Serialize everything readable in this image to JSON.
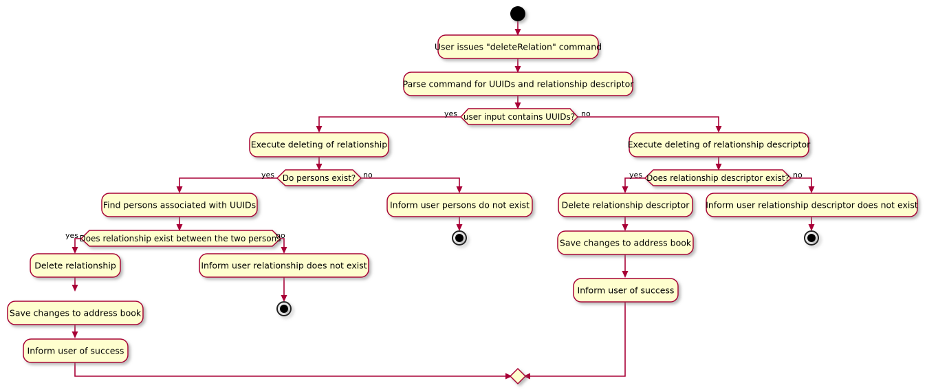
{
  "diagram": {
    "type": "uml-activity-diagram",
    "title": "deleteRelation command activity diagram",
    "background_color": "#FFFFFF",
    "node_fill_color": "#FEFECE",
    "node_border_color": "#A80036",
    "edge_color": "#A80036",
    "text_color": "#000000"
  },
  "start_node": {
    "label": "start"
  },
  "activities": [
    {
      "id": "a1",
      "label": "User issues \"deleteRelation\" command"
    },
    {
      "id": "a2",
      "label": "Parse command for UUIDs and relationship descriptor"
    },
    {
      "id": "a3",
      "label": "Execute deleting of relationship"
    },
    {
      "id": "a4",
      "label": "Execute deleting of relationship descriptor"
    },
    {
      "id": "a5",
      "label": "Find persons associated with UUIDs"
    },
    {
      "id": "a6",
      "label": "Inform user persons do not exist"
    },
    {
      "id": "a7",
      "label": "Delete relationship descriptor"
    },
    {
      "id": "a8",
      "label": "Inform user relationship descriptor does not exist"
    },
    {
      "id": "a9",
      "label": "Delete relationship"
    },
    {
      "id": "a10",
      "label": "Inform user relationship does not exist"
    },
    {
      "id": "a11",
      "label": "Save changes to address book"
    },
    {
      "id": "a12",
      "label": "Inform user of success"
    },
    {
      "id": "a13",
      "label": "Save changes to address book"
    },
    {
      "id": "a14",
      "label": "Inform user of success"
    }
  ],
  "decisions": [
    {
      "id": "d1",
      "label": "user input contains UUIDs?",
      "yes": "yes",
      "no": "no"
    },
    {
      "id": "d2",
      "label": "Do persons exist?",
      "yes": "yes",
      "no": "no"
    },
    {
      "id": "d3",
      "label": "Does relationship descriptor exist?",
      "yes": "yes",
      "no": "no"
    },
    {
      "id": "d4",
      "label": "Does relationship exist between the two persons",
      "yes": "yes",
      "no": "no"
    }
  ],
  "end_nodes": [
    {
      "id": "e1",
      "label": "end"
    },
    {
      "id": "e2",
      "label": "end"
    },
    {
      "id": "e3",
      "label": "end"
    }
  ],
  "merge_node": {
    "id": "m1",
    "label": "merge"
  }
}
